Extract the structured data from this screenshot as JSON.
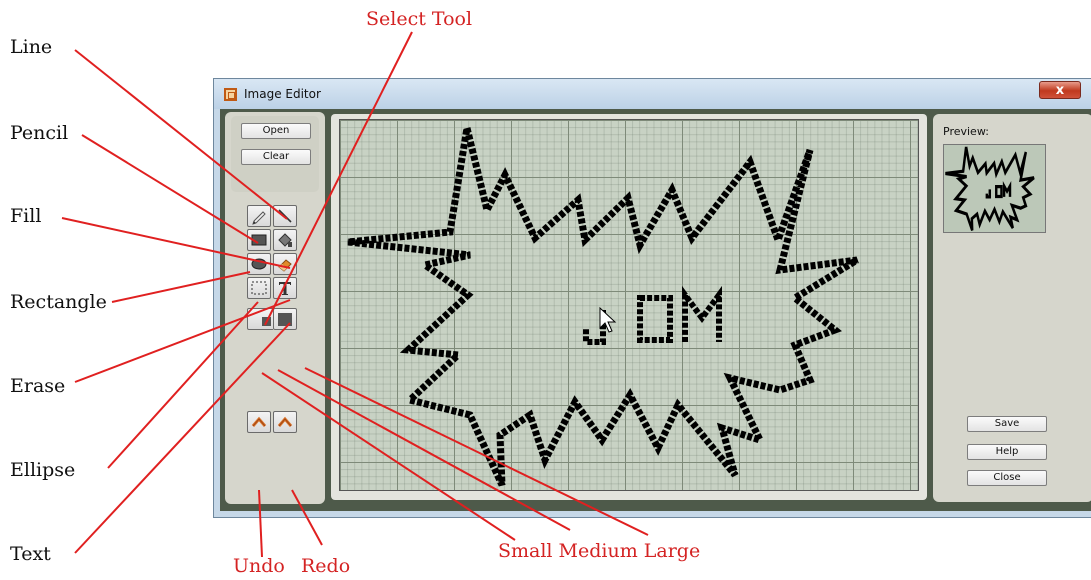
{
  "window": {
    "title": "Image Editor",
    "close_glyph": "x"
  },
  "file_buttons": {
    "open": "Open",
    "clear": "Clear"
  },
  "preview": {
    "label": "Preview:"
  },
  "actions": {
    "save": "Save",
    "help": "Help",
    "close": "Close"
  },
  "tools": [
    "pencil-icon",
    "line-icon",
    "rectangle-icon",
    "fill-icon",
    "ellipse-icon",
    "erase-icon",
    "select-icon",
    "text-icon",
    "small-brush-icon",
    "medium-brush-icon",
    "large-brush-icon",
    "undo-icon",
    "redo-icon"
  ],
  "canvas_text": "JOM",
  "callouts": {
    "line": "Line",
    "pencil": "Pencil",
    "fill": "Fill",
    "rectangle": "Rectangle",
    "erase": "Erase",
    "ellipse": "Ellipse",
    "text": "Text",
    "select_tool": "Select Tool",
    "undo": "Undo",
    "redo": "Redo",
    "sizes": "Small Medium Large"
  },
  "colors": {
    "annotation": "#d42323",
    "pixel": "#000000",
    "canvas": "#c8d2c4"
  }
}
